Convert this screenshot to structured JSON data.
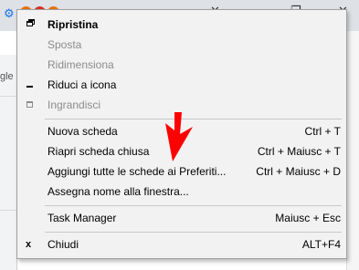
{
  "menu": {
    "restore": "Ripristina",
    "move": "Sposta",
    "resize": "Ridimensiona",
    "minimize": "Riduci a icona",
    "maximize": "Ingrandisci",
    "new_tab": {
      "label": "Nuova scheda",
      "shortcut": "Ctrl + T"
    },
    "reopen_tab": {
      "label": "Riapri scheda chiusa",
      "shortcut": "Ctrl + Maiusc + T"
    },
    "bookmark_all": {
      "label": "Aggiungi tutte le schede ai Preferiti...",
      "shortcut": "Ctrl + Maiusc + D"
    },
    "name_window": {
      "label": "Assegna nome alla finestra..."
    },
    "task_manager": {
      "label": "Task Manager",
      "shortcut": "Maiusc + Esc"
    },
    "close": {
      "label": "Chiudi",
      "shortcut": "ALT+F4"
    }
  },
  "background": {
    "left_text": "gle ."
  },
  "colors": {
    "menu_bg": "#f2f2f2",
    "disabled_text": "#8c8c8c",
    "annotation_arrow": "#ff0000"
  }
}
